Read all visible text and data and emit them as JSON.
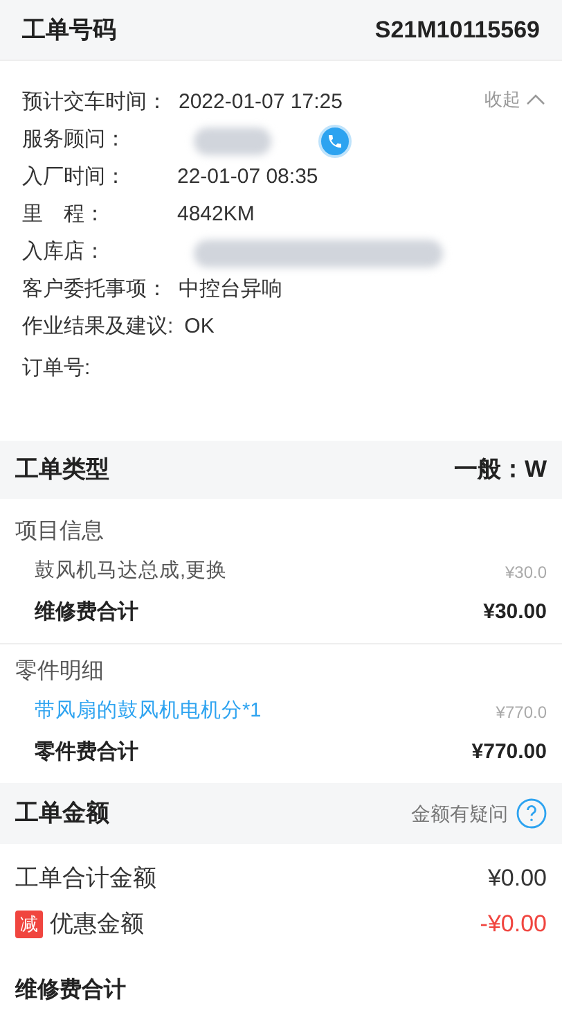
{
  "header": {
    "label": "工单号码",
    "value": "S21M10115569"
  },
  "info": {
    "collapse": "收起",
    "fields": [
      {
        "label": "预计交车时间：",
        "value": "2022-01-07 17:25"
      },
      {
        "label": "服务顾问：",
        "redacted": true,
        "phone": true
      },
      {
        "label": "入厂时间：",
        "value": "22-01-07 08:35"
      },
      {
        "label": "里　程：",
        "value": "4842KM"
      },
      {
        "label": "入库店：",
        "redacted": true,
        "wide": true
      },
      {
        "label": "客户委托事项：",
        "value": "中控台异响"
      },
      {
        "label": "作业结果及建议:",
        "value": "OK"
      },
      {
        "label": "订单号:"
      }
    ]
  },
  "order_type": {
    "label": "工单类型",
    "value": "一般：W"
  },
  "groups": [
    {
      "title": "项目信息",
      "items": [
        {
          "name": "鼓风机马达总成,更换",
          "price": "¥30.0",
          "link": false
        }
      ],
      "total_label": "维修费合计",
      "total": "¥30.00"
    },
    {
      "title": "零件明细",
      "items": [
        {
          "name": "带风扇的鼓风机电机分*1",
          "price": "¥770.0",
          "link": true
        }
      ],
      "total_label": "零件费合计",
      "total": "¥770.00"
    }
  ],
  "amount": {
    "label": "工单金额",
    "question": "金额有疑问",
    "rows": [
      {
        "label": "工单合计金额",
        "value": "¥0.00",
        "kind": "plain"
      },
      {
        "label": "优惠金额",
        "badge": "减",
        "value": "-¥0.00",
        "kind": "discount"
      }
    ],
    "footer_label": "维修费合计"
  }
}
